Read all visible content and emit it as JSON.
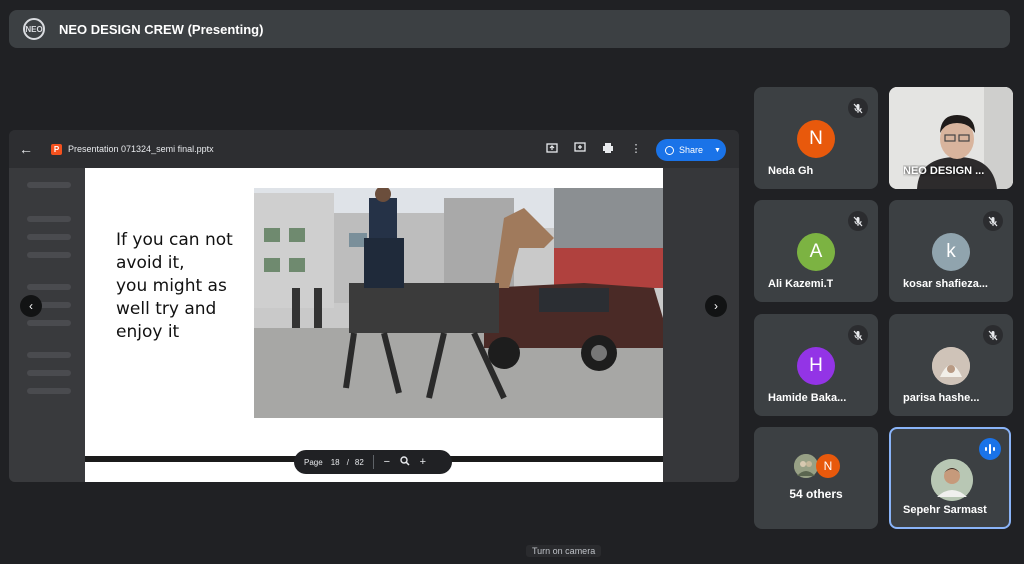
{
  "meeting": {
    "title": "NEO DESIGN CREW (Presenting)",
    "logo_text": "NEO"
  },
  "viewer": {
    "file_name": "Presentation 071324_semi final.pptx",
    "share_label": "Share",
    "icons": [
      "open-in-new-icon",
      "add-comment-icon",
      "print-icon",
      "more-vert-icon"
    ]
  },
  "slide": {
    "text": "If you can not\navoid it,\nyou might as\nwell try and\nenjoy it"
  },
  "pager": {
    "label": "Page",
    "current": "18",
    "separator": "/",
    "total": "82"
  },
  "participants": [
    {
      "name": "Neda Gh",
      "initial": "N",
      "color": "#e8590c",
      "muted": true
    },
    {
      "name": "NEO DESIGN ...",
      "video": true
    },
    {
      "name": "Ali Kazemi.T",
      "initial": "A",
      "color": "#7cb342",
      "muted": true
    },
    {
      "name": "kosar shafieza...",
      "initial": "k",
      "color": "#90a4ae",
      "muted": true
    },
    {
      "name": "Hamide Baka...",
      "initial": "H",
      "color": "#9334e6",
      "muted": true
    },
    {
      "name": "parisa hashe...",
      "photo": true,
      "muted": true
    },
    {
      "name": "54 others",
      "others_initial": "N",
      "color": "#e8590c"
    },
    {
      "name": "Sepehr Sarmast",
      "photo": true,
      "speaking": true
    }
  ],
  "hint": "Turn on camera",
  "colors": {
    "accent": "#1a73e8",
    "tile_bg": "#3c4043",
    "page_bg": "#202124"
  }
}
